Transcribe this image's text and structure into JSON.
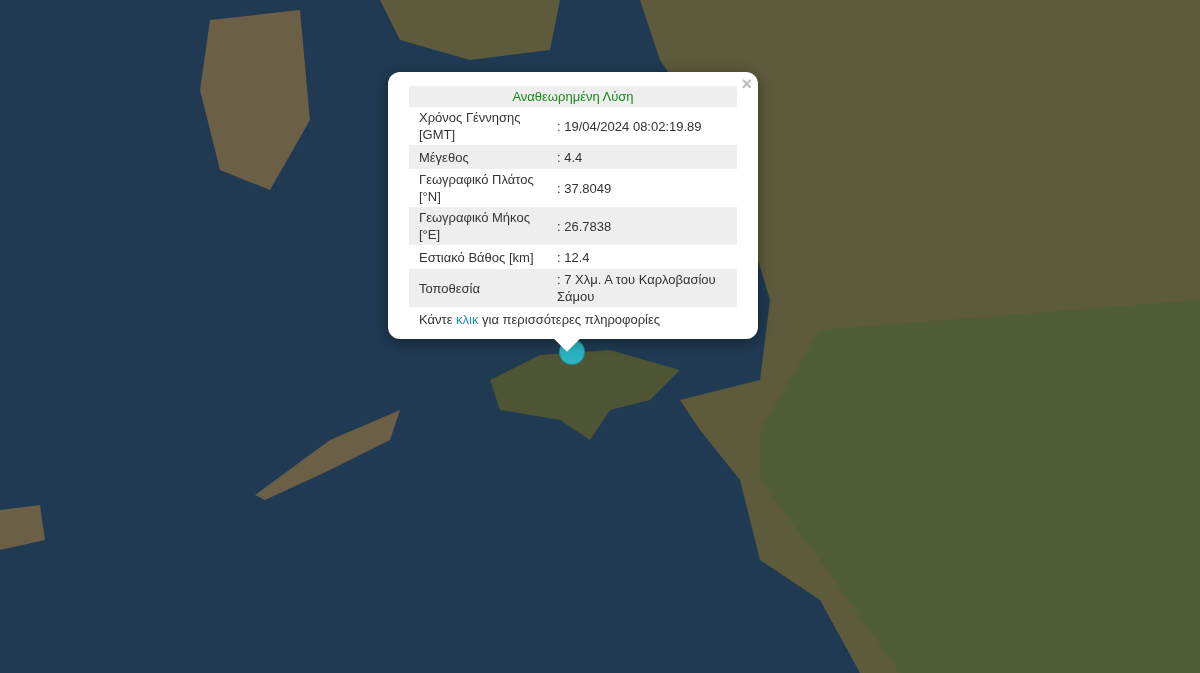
{
  "popup": {
    "close": "×",
    "title": "Αναθεωρημένη Λύση",
    "rows": [
      {
        "label": "Χρόνος Γέννησης [GMT]",
        "value": ": 19/04/2024 08:02:19.89"
      },
      {
        "label": "Μέγεθος",
        "value": ": 4.4"
      },
      {
        "label": "Γεωγραφικό Πλάτος [°N]",
        "value": ": 37.8049"
      },
      {
        "label": "Γεωγραφικό Μήκος [°E]",
        "value": ": 26.7838"
      },
      {
        "label": "Εστιακό Βάθος [km]",
        "value": ": 12.4"
      },
      {
        "label": "Τοποθεσία",
        "value": ": 7 Χλμ. Α του Καρλοβασίου Σάμου"
      }
    ],
    "footer": {
      "before": "Κάντε ",
      "link": "κλικ",
      "after": " για περισσότερες πληροφορίες"
    }
  }
}
